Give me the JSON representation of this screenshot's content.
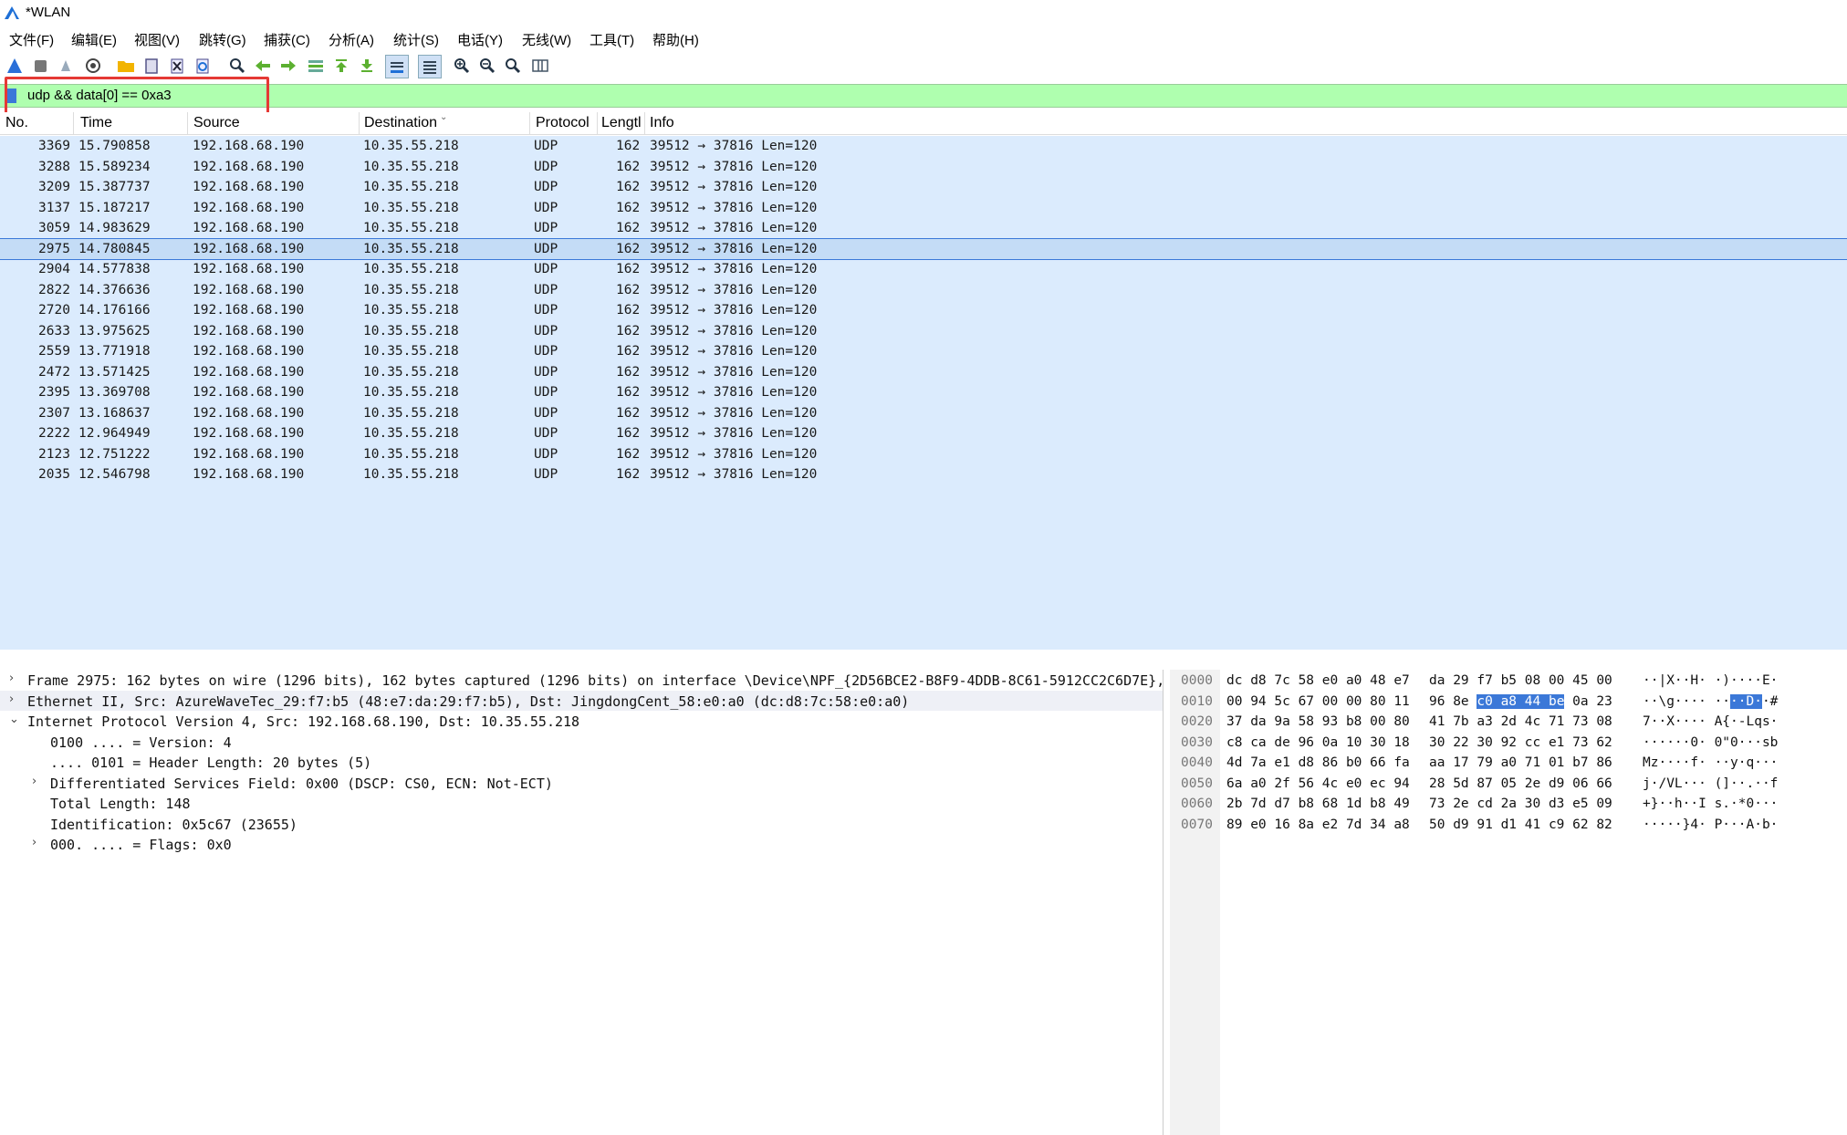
{
  "window": {
    "title": "*WLAN"
  },
  "menu": [
    "文件(F)",
    "编辑(E)",
    "视图(V)",
    "跳转(G)",
    "捕获(C)",
    "分析(A)",
    "统计(S)",
    "电话(Y)",
    "无线(W)",
    "工具(T)",
    "帮助(H)"
  ],
  "toolbar": {
    "icons": [
      "shark-fin-start-icon",
      "stop-capture-icon",
      "restart-capture-icon",
      "capture-options-icon",
      "open-file-icon",
      "save-file-icon",
      "close-file-icon",
      "reload-file-icon",
      "find-packet-icon",
      "go-back-icon",
      "go-forward-icon",
      "go-to-packet-icon",
      "go-first-icon",
      "go-last-icon",
      "autoscroll-icon",
      "colorize-icon",
      "zoom-in-icon",
      "zoom-out-icon",
      "zoom-normal-icon",
      "resize-columns-icon"
    ]
  },
  "filter": {
    "value": "udp && data[0] == 0xa3"
  },
  "columns": [
    "No.",
    "Time",
    "Source",
    "Destination",
    "Protocol",
    "Lengtl",
    "Info"
  ],
  "packets": [
    {
      "no": "3369",
      "time": "15.790858",
      "src": "192.168.68.190",
      "dst": "10.35.55.218",
      "proto": "UDP",
      "len": "162",
      "info": "39512 → 37816 Len=120"
    },
    {
      "no": "3288",
      "time": "15.589234",
      "src": "192.168.68.190",
      "dst": "10.35.55.218",
      "proto": "UDP",
      "len": "162",
      "info": "39512 → 37816 Len=120"
    },
    {
      "no": "3209",
      "time": "15.387737",
      "src": "192.168.68.190",
      "dst": "10.35.55.218",
      "proto": "UDP",
      "len": "162",
      "info": "39512 → 37816 Len=120"
    },
    {
      "no": "3137",
      "time": "15.187217",
      "src": "192.168.68.190",
      "dst": "10.35.55.218",
      "proto": "UDP",
      "len": "162",
      "info": "39512 → 37816 Len=120"
    },
    {
      "no": "3059",
      "time": "14.983629",
      "src": "192.168.68.190",
      "dst": "10.35.55.218",
      "proto": "UDP",
      "len": "162",
      "info": "39512 → 37816 Len=120"
    },
    {
      "no": "2975",
      "time": "14.780845",
      "src": "192.168.68.190",
      "dst": "10.35.55.218",
      "proto": "UDP",
      "len": "162",
      "info": "39512 → 37816 Len=120",
      "selected": true
    },
    {
      "no": "2904",
      "time": "14.577838",
      "src": "192.168.68.190",
      "dst": "10.35.55.218",
      "proto": "UDP",
      "len": "162",
      "info": "39512 → 37816 Len=120"
    },
    {
      "no": "2822",
      "time": "14.376636",
      "src": "192.168.68.190",
      "dst": "10.35.55.218",
      "proto": "UDP",
      "len": "162",
      "info": "39512 → 37816 Len=120"
    },
    {
      "no": "2720",
      "time": "14.176166",
      "src": "192.168.68.190",
      "dst": "10.35.55.218",
      "proto": "UDP",
      "len": "162",
      "info": "39512 → 37816 Len=120"
    },
    {
      "no": "2633",
      "time": "13.975625",
      "src": "192.168.68.190",
      "dst": "10.35.55.218",
      "proto": "UDP",
      "len": "162",
      "info": "39512 → 37816 Len=120"
    },
    {
      "no": "2559",
      "time": "13.771918",
      "src": "192.168.68.190",
      "dst": "10.35.55.218",
      "proto": "UDP",
      "len": "162",
      "info": "39512 → 37816 Len=120"
    },
    {
      "no": "2472",
      "time": "13.571425",
      "src": "192.168.68.190",
      "dst": "10.35.55.218",
      "proto": "UDP",
      "len": "162",
      "info": "39512 → 37816 Len=120"
    },
    {
      "no": "2395",
      "time": "13.369708",
      "src": "192.168.68.190",
      "dst": "10.35.55.218",
      "proto": "UDP",
      "len": "162",
      "info": "39512 → 37816 Len=120"
    },
    {
      "no": "2307",
      "time": "13.168637",
      "src": "192.168.68.190",
      "dst": "10.35.55.218",
      "proto": "UDP",
      "len": "162",
      "info": "39512 → 37816 Len=120"
    },
    {
      "no": "2222",
      "time": "12.964949",
      "src": "192.168.68.190",
      "dst": "10.35.55.218",
      "proto": "UDP",
      "len": "162",
      "info": "39512 → 37816 Len=120"
    },
    {
      "no": "2123",
      "time": "12.751222",
      "src": "192.168.68.190",
      "dst": "10.35.55.218",
      "proto": "UDP",
      "len": "162",
      "info": "39512 → 37816 Len=120"
    },
    {
      "no": "2035",
      "time": "12.546798",
      "src": "192.168.68.190",
      "dst": "10.35.55.218",
      "proto": "UDP",
      "len": "162",
      "info": "39512 → 37816 Len=120"
    }
  ],
  "tree": [
    {
      "tog": "›",
      "text": "Frame 2975: 162 bytes on wire (1296 bits), 162 bytes captured (1296 bits) on interface \\Device\\NPF_{2D56BCE2-B8F9-4DDB-8C61-5912CC2C6D7E}, :"
    },
    {
      "tog": "›",
      "text": "Ethernet II, Src: AzureWaveTec_29:f7:b5 (48:e7:da:29:f7:b5), Dst: JingdongCent_58:e0:a0 (dc:d8:7c:58:e0:a0)"
    },
    {
      "tog": "⌄",
      "text": "Internet Protocol Version 4, Src: 192.168.68.190, Dst: 10.35.55.218"
    },
    {
      "tog": "",
      "text": "0100 .... = Version: 4",
      "indent": 1
    },
    {
      "tog": "",
      "text": ".... 0101 = Header Length: 20 bytes (5)",
      "indent": 1
    },
    {
      "tog": "›",
      "text": "Differentiated Services Field: 0x00 (DSCP: CS0, ECN: Not-ECT)",
      "indent": 1
    },
    {
      "tog": "",
      "text": "Total Length: 148",
      "indent": 1
    },
    {
      "tog": "",
      "text": "Identification: 0x5c67 (23655)",
      "indent": 1
    },
    {
      "tog": "›",
      "text": "000. .... = Flags: 0x0",
      "indent": 1
    }
  ],
  "hex": [
    {
      "off": "0000",
      "b1": "dc d8 7c 58 e0 a0 48 e7",
      "b2": "da 29 f7 b5 08 00 45 00",
      "ascii": "··|X··H· ·)····E·"
    },
    {
      "off": "0010",
      "b1": "00 94 5c 67 00 00 80 11",
      "b2pre": "96 8e ",
      "b2hl": "c0 a8 44 be",
      "b2post": " 0a 23",
      "asciipre": "··\\g···· ··",
      "asciihl": "··D·",
      "asciipost": "·#"
    },
    {
      "off": "0020",
      "b1": "37 da 9a 58 93 b8 00 80",
      "b2": "41 7b a3 2d 4c 71 73 08",
      "ascii": "7··X···· A{·-Lqs·"
    },
    {
      "off": "0030",
      "b1": "c8 ca de 96 0a 10 30 18",
      "b2": "30 22 30 92 cc e1 73 62",
      "ascii": "······0· 0\"0···sb"
    },
    {
      "off": "0040",
      "b1": "4d 7a e1 d8 86 b0 66 fa",
      "b2": "aa 17 79 a0 71 01 b7 86",
      "ascii": "Mz····f· ··y·q···"
    },
    {
      "off": "0050",
      "b1": "6a a0 2f 56 4c e0 ec 94",
      "b2": "28 5d 87 05 2e d9 06 66",
      "ascii": "j·/VL··· (]··.··f"
    },
    {
      "off": "0060",
      "b1": "2b 7d d7 b8 68 1d b8 49",
      "b2": "73 2e cd 2a 30 d3 e5 09",
      "ascii": "+}··h··I s.·*0···"
    },
    {
      "off": "0070",
      "b1": "89 e0 16 8a e2 7d 34 a8",
      "b2": "50 d9 91 d1 41 c9 62 82",
      "ascii": "·····}4· P···A·b·"
    }
  ]
}
